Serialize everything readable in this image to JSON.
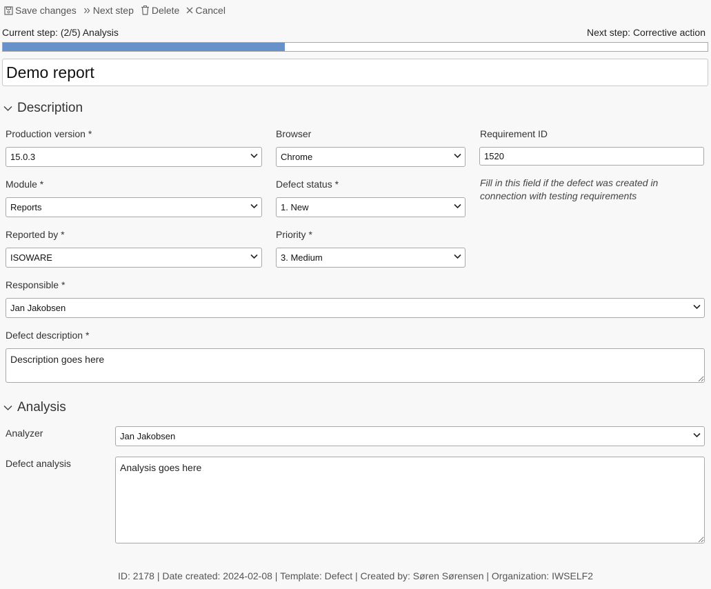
{
  "toolbar": {
    "save_label": "Save changes",
    "next_label": "Next step",
    "delete_label": "Delete",
    "cancel_label": "Cancel"
  },
  "step": {
    "current": "Current step: (2/5) Analysis",
    "next": "Next step: Corrective action",
    "progress": 0.4
  },
  "report": {
    "title": "Demo report"
  },
  "description": {
    "heading": "Description",
    "production_version": {
      "label": "Production version *",
      "value": "15.0.3"
    },
    "browser": {
      "label": "Browser",
      "value": "Chrome"
    },
    "requirement_id": {
      "label": "Requirement ID",
      "value": "1520",
      "hint": "Fill in this field if the defect was created in connection with testing requirements"
    },
    "module": {
      "label": "Module *",
      "value": "Reports"
    },
    "defect_status": {
      "label": "Defect status *",
      "value": "1. New"
    },
    "reported_by": {
      "label": "Reported by *",
      "value": "ISOWARE"
    },
    "priority": {
      "label": "Priority *",
      "value": "3. Medium"
    },
    "responsible": {
      "label": "Responsible *",
      "value": "Jan Jakobsen"
    },
    "defect_description": {
      "label": "Defect description *",
      "value": "Description goes here"
    }
  },
  "analysis": {
    "heading": "Analysis",
    "analyzer": {
      "label": "Analyzer",
      "value": "Jan Jakobsen"
    },
    "defect_analysis": {
      "label": "Defect analysis",
      "value": "Analysis goes here"
    }
  },
  "footer": {
    "text": "ID: 2178 | Date created: 2024-02-08 | Template: Defect | Created by: Søren Sørensen | Organization: IWSELF2"
  },
  "icons": [
    "save-icon",
    "double-chevron-right-icon",
    "trash-icon",
    "close-icon",
    "chevron-down-icon"
  ]
}
